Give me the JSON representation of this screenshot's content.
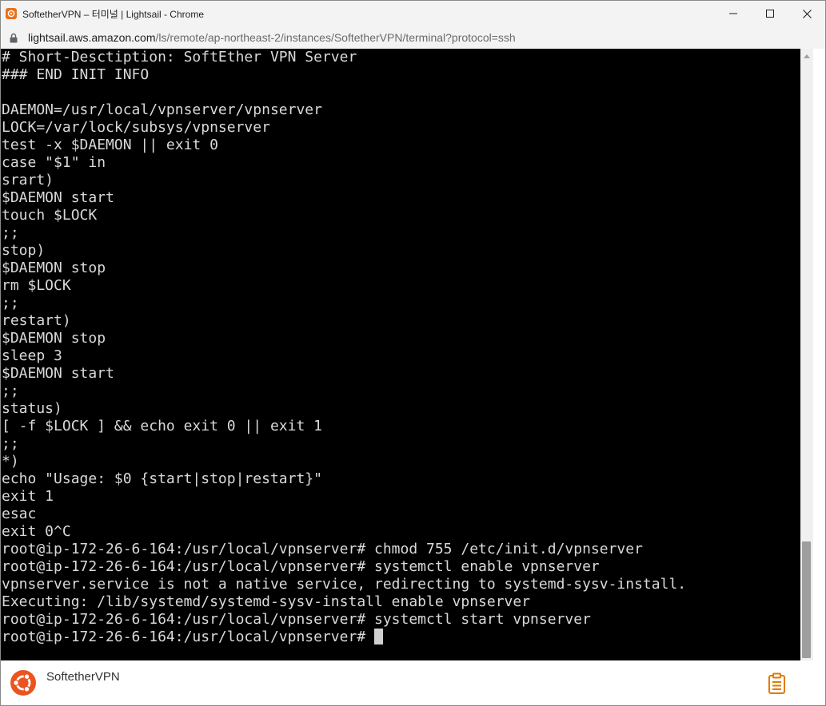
{
  "window": {
    "title": "SoftetherVPN – 터미널 | Lightsail - Chrome",
    "controls": [
      "minimize-icon",
      "maximize-icon",
      "close-icon"
    ]
  },
  "address_bar": {
    "host": "lightsail.aws.amazon.com",
    "path": "/ls/remote/ap-northeast-2/instances/SoftetherVPN/terminal?protocol=ssh"
  },
  "terminal": {
    "lines": [
      "# Short-Desctiption: SoftEther VPN Server",
      "### END INIT INFO",
      "",
      "DAEMON=/usr/local/vpnserver/vpnserver",
      "LOCK=/var/lock/subsys/vpnserver",
      "test -x $DAEMON || exit 0",
      "case \"$1\" in",
      "srart)",
      "$DAEMON start",
      "touch $LOCK",
      ";;",
      "stop)",
      "$DAEMON stop",
      "rm $LOCK",
      ";;",
      "restart)",
      "$DAEMON stop",
      "sleep 3",
      "$DAEMON start",
      ";;",
      "status)",
      "[ -f $LOCK ] && echo exit 0 || exit 1",
      ";;",
      "*)",
      "echo \"Usage: $0 {start|stop|restart}\"",
      "exit 1",
      "esac",
      "exit 0^C",
      "root@ip-172-26-6-164:/usr/local/vpnserver# chmod 755 /etc/init.d/vpnserver",
      "root@ip-172-26-6-164:/usr/local/vpnserver# systemctl enable vpnserver",
      "vpnserver.service is not a native service, redirecting to systemd-sysv-install.",
      "Executing: /lib/systemd/systemd-sysv-install enable vpnserver",
      "root@ip-172-26-6-164:/usr/local/vpnserver# systemctl start vpnserver"
    ],
    "prompt": "root@ip-172-26-6-164:/usr/local/vpnserver# ",
    "colors": {
      "background": "#000000",
      "foreground": "#d9d9d9"
    }
  },
  "footer": {
    "instance_name": "SoftetherVPN",
    "os_icon": "ubuntu-icon",
    "action_icon": "clipboard-icon",
    "accent": "#e95420"
  }
}
